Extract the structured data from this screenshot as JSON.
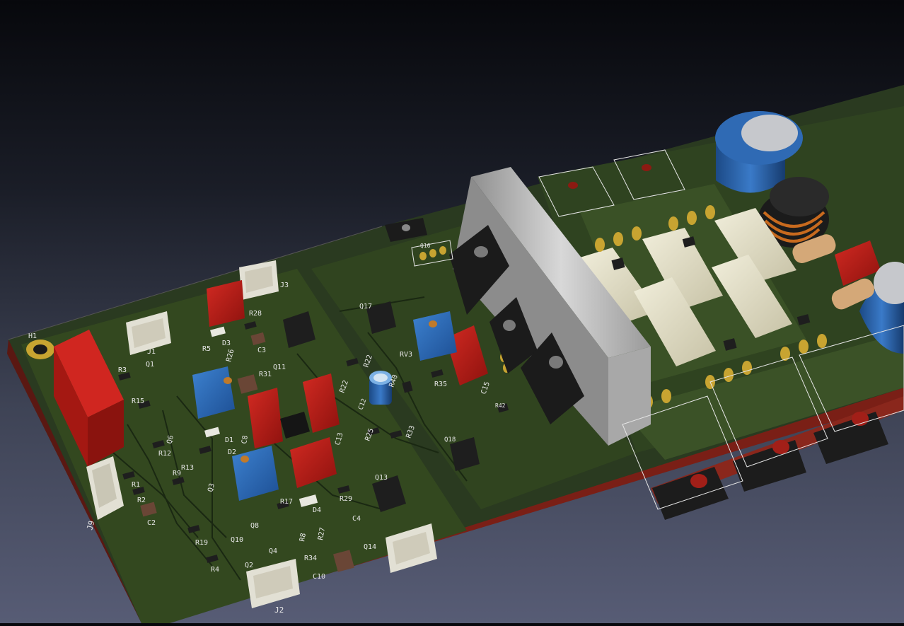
{
  "colors": {
    "background_top": "#07080c",
    "background_bottom": "#575c75",
    "board_edge": "#7a1f16",
    "board": "#2a3a20",
    "copper_zone": "#3c5226",
    "silkscreen": "#e6e6e6",
    "pad_gold": "#c8a431",
    "film_cap_red": "#b41a14",
    "trimpot_blue": "#2b6ab8",
    "connector_white": "#e2e0d4",
    "heatsink_grey": "#b3b3b3",
    "power_resistor_cream": "#e4e0c8",
    "electrolytic_blue": "#2861a8"
  },
  "labels": {
    "H1": "H1",
    "J1": "J1",
    "J2": "J2",
    "J3": "J3",
    "J9": "J9",
    "R1": "R1",
    "R2": "R2",
    "R3": "R3",
    "R4": "R4",
    "R5": "R5",
    "R8": "R8",
    "R9": "R9",
    "R12": "R12",
    "R13": "R13",
    "R15": "R15",
    "R17": "R17",
    "R19": "R19",
    "R22": "R22",
    "R25": "R25",
    "R26": "R26",
    "R27": "R27",
    "R28": "R28",
    "R29": "R29",
    "R31": "R31",
    "R33": "R33",
    "R34": "R34",
    "R35": "R35",
    "R40": "R40",
    "R42": "R42",
    "C2": "C2",
    "C3": "C3",
    "C4": "C4",
    "C8": "C8",
    "C10": "C10",
    "C12": "C12",
    "C13": "C13",
    "C15": "C15",
    "D1": "D1",
    "D2": "D2",
    "D3": "D3",
    "D4": "D4",
    "Q1": "Q1",
    "Q2": "Q2",
    "Q3": "Q3",
    "Q4": "Q4",
    "Q6": "Q6",
    "Q8": "Q8",
    "Q10": "Q10",
    "Q11": "Q11",
    "Q13": "Q13",
    "Q14": "Q14",
    "Q16": "Q16",
    "Q17": "Q17",
    "Q18": "Q18",
    "RV3": "RV3"
  }
}
